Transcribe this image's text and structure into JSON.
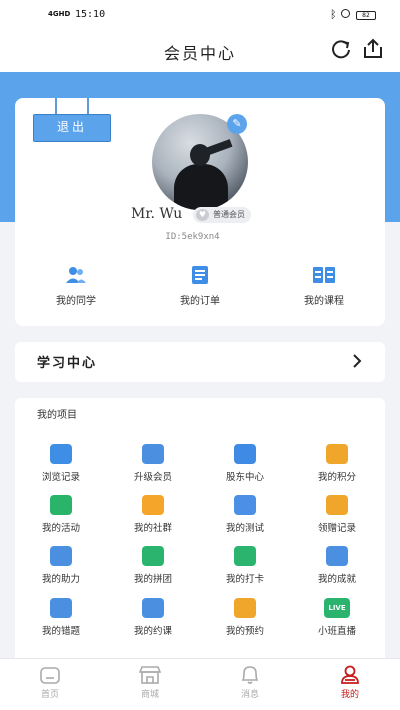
{
  "status_bar": {
    "signal": "4GHD",
    "time": "15:10",
    "battery": "82"
  },
  "header": {
    "title": "会员中心"
  },
  "profile": {
    "logout_label": "退出",
    "username": "Mr. Wu",
    "member_level": "普通会员",
    "user_id": "ID:5ek9xn4",
    "quick_links": [
      {
        "label": "我的同学",
        "icon": "classmates-icon"
      },
      {
        "label": "我的订单",
        "icon": "orders-icon"
      },
      {
        "label": "我的课程",
        "icon": "courses-icon"
      }
    ]
  },
  "study_center": {
    "label": "学习中心"
  },
  "projects": {
    "title": "我的项目",
    "items": [
      {
        "label": "浏览记录",
        "icon": "clock-icon",
        "color": "#3e8ee6"
      },
      {
        "label": "升级会员",
        "icon": "crown-icon",
        "color": "#4a8fe0"
      },
      {
        "label": "股东中心",
        "icon": "money-bag-icon",
        "color": "#3f8ae4"
      },
      {
        "label": "我的积分",
        "icon": "points-icon",
        "color": "#f0a62a"
      },
      {
        "label": "我的活动",
        "icon": "flag-icon",
        "color": "#29b46a"
      },
      {
        "label": "我的社群",
        "icon": "community-icon",
        "color": "#f4a52a"
      },
      {
        "label": "我的测试",
        "icon": "code-icon",
        "color": "#4c8fe6"
      },
      {
        "label": "领赠记录",
        "icon": "gift-icon",
        "color": "#f0a62a"
      },
      {
        "label": "我的助力",
        "icon": "thumb-up-icon",
        "color": "#4a8fe0"
      },
      {
        "label": "我的拼团",
        "icon": "coupon-icon",
        "color": "#2bb46e"
      },
      {
        "label": "我的打卡",
        "icon": "checkin-icon",
        "color": "#2bb46e"
      },
      {
        "label": "我的成就",
        "icon": "medal-icon",
        "color": "#4a8fe0"
      },
      {
        "label": "我的错题",
        "icon": "wrong-notebook-icon",
        "color": "#4a8fe0"
      },
      {
        "label": "我的约课",
        "icon": "book-class-icon",
        "color": "#4a8fe0"
      },
      {
        "label": "我的预约",
        "icon": "appointment-icon",
        "color": "#f0a62a"
      },
      {
        "label": "小班直播",
        "icon": "live-icon",
        "color": "#2bb46e",
        "badge": "LIVE"
      }
    ]
  },
  "tabbar": {
    "tabs": [
      {
        "label": "首页",
        "icon": "home-icon"
      },
      {
        "label": "商城",
        "icon": "shop-icon"
      },
      {
        "label": "消息",
        "icon": "bell-icon"
      },
      {
        "label": "我的",
        "icon": "user-icon"
      }
    ],
    "active_index": 3,
    "active_color": "#c81b1b",
    "inactive_color": "#aaaaaa"
  },
  "colors": {
    "accent": "#5ba4ec",
    "brand_dark": "#3b7fc6"
  }
}
